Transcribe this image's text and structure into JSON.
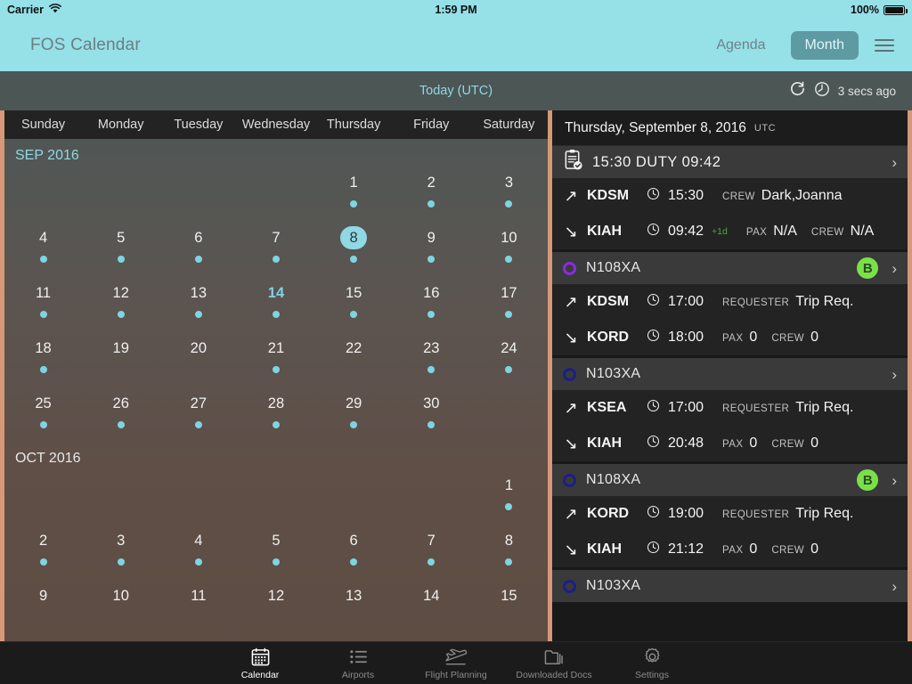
{
  "status_bar": {
    "carrier": "Carrier",
    "wifi_icon": "wifi-icon",
    "time": "1:59 PM",
    "battery_percent": "100%",
    "battery_icon": "battery-full-icon"
  },
  "nav_bar": {
    "app_title": "FOS Calendar",
    "agenda_label": "Agenda",
    "month_label": "Month",
    "menu_icon": "list-menu-icon",
    "bg_color": "#96e0e8",
    "active_segment_color": "#5d9aa2"
  },
  "sync_bar": {
    "today_label": "Today (UTC)",
    "refresh_icon": "refresh-icon",
    "clock_icon": "clock-icon",
    "last_sync": "3 secs ago",
    "link_color": "#8fd8e4"
  },
  "calendar": {
    "weekdays": [
      "Sunday",
      "Monday",
      "Tuesday",
      "Wednesday",
      "Thursday",
      "Friday",
      "Saturday"
    ],
    "accent_color": "#7ed4e2",
    "months": [
      {
        "label": "SEP 2016",
        "weeks": [
          [
            {
              "day": "",
              "dot": false
            },
            {
              "day": "",
              "dot": false
            },
            {
              "day": "",
              "dot": false
            },
            {
              "day": "",
              "dot": false
            },
            {
              "day": "1",
              "dot": true
            },
            {
              "day": "2",
              "dot": true
            },
            {
              "day": "3",
              "dot": true
            }
          ],
          [
            {
              "day": "4",
              "dot": true
            },
            {
              "day": "5",
              "dot": true
            },
            {
              "day": "6",
              "dot": true
            },
            {
              "day": "7",
              "dot": true
            },
            {
              "day": "8",
              "dot": true,
              "today": true
            },
            {
              "day": "9",
              "dot": true
            },
            {
              "day": "10",
              "dot": true
            }
          ],
          [
            {
              "day": "11",
              "dot": true
            },
            {
              "day": "12",
              "dot": true
            },
            {
              "day": "13",
              "dot": true
            },
            {
              "day": "14",
              "dot": true,
              "marked": true
            },
            {
              "day": "15",
              "dot": true
            },
            {
              "day": "16",
              "dot": true
            },
            {
              "day": "17",
              "dot": true
            }
          ],
          [
            {
              "day": "18",
              "dot": true
            },
            {
              "day": "19",
              "dot": false
            },
            {
              "day": "20",
              "dot": false
            },
            {
              "day": "21",
              "dot": true
            },
            {
              "day": "22",
              "dot": false
            },
            {
              "day": "23",
              "dot": true
            },
            {
              "day": "24",
              "dot": true
            }
          ],
          [
            {
              "day": "25",
              "dot": true
            },
            {
              "day": "26",
              "dot": true
            },
            {
              "day": "27",
              "dot": true
            },
            {
              "day": "28",
              "dot": true
            },
            {
              "day": "29",
              "dot": true
            },
            {
              "day": "30",
              "dot": true
            },
            {
              "day": "",
              "dot": false
            }
          ]
        ]
      },
      {
        "label": "OCT 2016",
        "weeks": [
          [
            {
              "day": "",
              "dot": false
            },
            {
              "day": "",
              "dot": false
            },
            {
              "day": "",
              "dot": false
            },
            {
              "day": "",
              "dot": false
            },
            {
              "day": "",
              "dot": false
            },
            {
              "day": "",
              "dot": false
            },
            {
              "day": "1",
              "dot": true
            }
          ],
          [
            {
              "day": "2",
              "dot": true
            },
            {
              "day": "3",
              "dot": true
            },
            {
              "day": "4",
              "dot": true
            },
            {
              "day": "5",
              "dot": true
            },
            {
              "day": "6",
              "dot": true
            },
            {
              "day": "7",
              "dot": true
            },
            {
              "day": "8",
              "dot": true
            }
          ],
          [
            {
              "day": "9",
              "dot": false
            },
            {
              "day": "10",
              "dot": false
            },
            {
              "day": "11",
              "dot": false
            },
            {
              "day": "12",
              "dot": false
            },
            {
              "day": "13",
              "dot": false
            },
            {
              "day": "14",
              "dot": false
            },
            {
              "day": "15",
              "dot": false
            }
          ]
        ]
      }
    ]
  },
  "agenda": {
    "date_title": "Thursday, September 8, 2016",
    "timezone": "UTC",
    "duty_card": {
      "icon": "clipboard-check-icon",
      "start_time": "15:30",
      "label": "DUTY",
      "end_time": "09:42",
      "chevron": "chevron-right-icon",
      "legs": [
        {
          "direction_icon": "arrow-depart-icon",
          "airport": "KDSM",
          "clock_icon": "clock-icon",
          "time": "15:30",
          "day_offset": "",
          "fields": [
            {
              "key": "CREW",
              "value": "Dark,Joanna"
            }
          ]
        },
        {
          "direction_icon": "arrow-arrive-icon",
          "airport": "KIAH",
          "clock_icon": "clock-icon",
          "time": "09:42",
          "day_offset": "+1d",
          "fields": [
            {
              "key": "PAX",
              "value": "N/A"
            },
            {
              "key": "CREW",
              "value": "N/A"
            }
          ]
        }
      ]
    },
    "flight_cards": [
      {
        "tail_number": "N108XA",
        "ring_color": "violet",
        "badge": "B",
        "chevron": "chevron-right-icon",
        "legs": [
          {
            "direction_icon": "arrow-depart-icon",
            "airport": "KDSM",
            "clock_icon": "clock-icon",
            "time": "17:00",
            "day_offset": "",
            "fields": [
              {
                "key": "REQUESTER",
                "value": "Trip Req."
              }
            ]
          },
          {
            "direction_icon": "arrow-arrive-icon",
            "airport": "KORD",
            "clock_icon": "clock-icon",
            "time": "18:00",
            "day_offset": "",
            "fields": [
              {
                "key": "PAX",
                "value": "0"
              },
              {
                "key": "CREW",
                "value": "0"
              }
            ]
          }
        ]
      },
      {
        "tail_number": "N103XA",
        "ring_color": "navy",
        "badge": "",
        "chevron": "chevron-right-icon",
        "legs": [
          {
            "direction_icon": "arrow-depart-icon",
            "airport": "KSEA",
            "clock_icon": "clock-icon",
            "time": "17:00",
            "day_offset": "",
            "fields": [
              {
                "key": "REQUESTER",
                "value": "Trip Req."
              }
            ]
          },
          {
            "direction_icon": "arrow-arrive-icon",
            "airport": "KIAH",
            "clock_icon": "clock-icon",
            "time": "20:48",
            "day_offset": "",
            "fields": [
              {
                "key": "PAX",
                "value": "0"
              },
              {
                "key": "CREW",
                "value": "0"
              }
            ]
          }
        ]
      },
      {
        "tail_number": "N108XA",
        "ring_color": "navy",
        "badge": "B",
        "chevron": "chevron-right-icon",
        "legs": [
          {
            "direction_icon": "arrow-depart-icon",
            "airport": "KORD",
            "clock_icon": "clock-icon",
            "time": "19:00",
            "day_offset": "",
            "fields": [
              {
                "key": "REQUESTER",
                "value": "Trip Req."
              }
            ]
          },
          {
            "direction_icon": "arrow-arrive-icon",
            "airport": "KIAH",
            "clock_icon": "clock-icon",
            "time": "21:12",
            "day_offset": "",
            "fields": [
              {
                "key": "PAX",
                "value": "0"
              },
              {
                "key": "CREW",
                "value": "0"
              }
            ]
          }
        ]
      },
      {
        "tail_number": "N103XA",
        "ring_color": "navy",
        "badge": "",
        "chevron": "chevron-right-icon",
        "legs": []
      }
    ],
    "badge_color": "#7ae04a"
  },
  "tab_bar": {
    "tabs": [
      {
        "label": "Calendar",
        "icon": "calendar-icon",
        "active": true
      },
      {
        "label": "Airports",
        "icon": "list-icon",
        "active": false
      },
      {
        "label": "Flight Planning",
        "icon": "airplane-takeoff-icon",
        "active": false
      },
      {
        "label": "Downloaded Docs",
        "icon": "folder-icon",
        "active": false
      },
      {
        "label": "Settings",
        "icon": "gear-icon",
        "active": false
      }
    ]
  }
}
